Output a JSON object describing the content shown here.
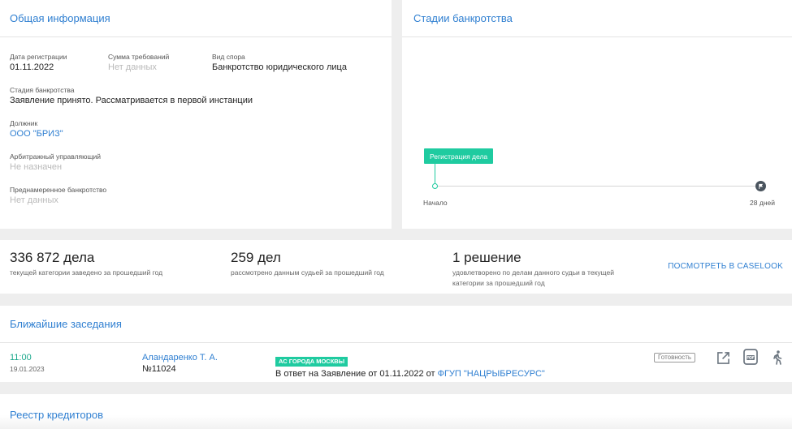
{
  "general": {
    "title": "Общая информация",
    "reg_date_label": "Дата регистрации",
    "reg_date": "01.11.2022",
    "claim_label": "Сумма требований",
    "claim_value": "Нет данных",
    "dispute_label": "Вид спора",
    "dispute_value": "Банкротство юридического лица",
    "stage_label": "Стадия банкротства",
    "stage_value": "Заявление принято. Рассматривается в первой инстанции",
    "debtor_label": "Должник",
    "debtor_value": "ООО \"БРИЗ\"",
    "manager_label": "Арбитражный управляющий",
    "manager_value": "Не назначен",
    "deliberate_label": "Преднамеренное банкротство",
    "deliberate_value": "Нет данных"
  },
  "stages": {
    "title": "Стадии банкротства",
    "marker_label": "Регистрация дела",
    "start_label": "Начало",
    "end_label": "28 дней"
  },
  "stats": {
    "s1_num": "336 872 дела",
    "s1_desc": "текущей категории заведено за прошедший год",
    "s2_num": "259 дел",
    "s2_desc": "рассмотрено данным судьей за прошедший год",
    "s3_num": "1 решение",
    "s3_desc": "удовлетворено по делам данного судьи в текущей категории за прошедший год",
    "link_label": "ПОСМОТРЕТЬ В CASELOOK"
  },
  "hearings": {
    "title": "Ближайшие заседания",
    "rows": [
      {
        "time": "11:00",
        "date": "19.01.2023",
        "judge": "Аландаренко Т. А.",
        "room": "№11024",
        "court": "АС ГОРОДА МОСКВЫ",
        "desc_prefix": "В ответ на Заявление от 01.11.2022 от",
        "desc_link": "ФГУП \"НАЦРЫБРЕСУРС\"",
        "status": "Готовность"
      }
    ]
  },
  "creditors": {
    "title": "Реестр кредиторов"
  },
  "colors": {
    "accent": "#2f7fd1",
    "green": "#1fcba0",
    "teal_time": "#1aa88b"
  }
}
